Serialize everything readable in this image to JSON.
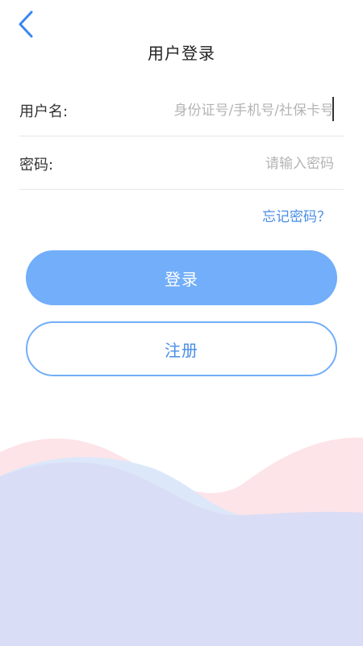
{
  "header": {
    "title": "用户登录"
  },
  "form": {
    "username_label": "用户名:",
    "username_placeholder": "身份证号/手机号/社保卡号",
    "password_label": "密码:",
    "password_placeholder": "请输入密码",
    "forgot_label": "忘记密码？"
  },
  "actions": {
    "login_label": "登录",
    "register_label": "注册"
  },
  "colors": {
    "accent": "#72aef9",
    "link": "#4a8ee6",
    "back_arrow": "#3a87f0",
    "wave_pink": "#fde4e8",
    "wave_lavender": "#d9dcf5",
    "wave_lightblue": "#dce8fa"
  },
  "icons": {
    "back": "chevron-left-icon"
  }
}
